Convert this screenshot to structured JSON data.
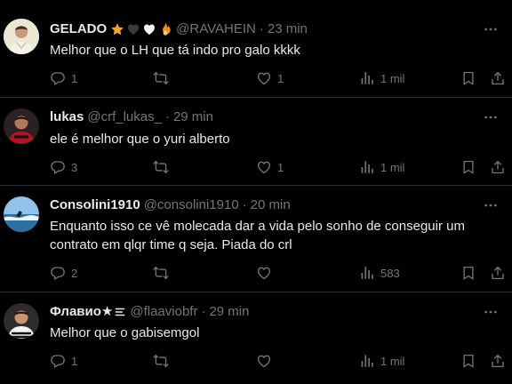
{
  "tweets": [
    {
      "name": "GELADO",
      "name_emojis": [
        "star",
        "black-heart",
        "white-heart",
        "fire"
      ],
      "handle": "@RAVAHEIN",
      "dot": "·",
      "time": "23 min",
      "text": "Melhor que o LH que tá indo pro galo kkkk",
      "replies": "1",
      "retweets": "",
      "likes": "1",
      "views": "1 mil"
    },
    {
      "name": "lukas",
      "handle": "@crf_lukas_",
      "dot": "·",
      "time": "29 min",
      "text": "ele é melhor que o yuri alberto",
      "replies": "3",
      "retweets": "",
      "likes": "1",
      "views": "1 mil"
    },
    {
      "name": "Consolini1910",
      "handle": "@consolini1910",
      "dot": "·",
      "time": "20 min",
      "text": "Enquanto isso ce vê molecada dar a vida pelo sonho de conseguir um contrato em qlqr time q seja. Piada do crl",
      "replies": "2",
      "retweets": "",
      "likes": "",
      "views": "583"
    },
    {
      "name": "Флавио★",
      "handle": "@flaaviobfr",
      "dot": "·",
      "time": "29 min",
      "text": "Melhor que o gabisemgol",
      "replies": "1",
      "retweets": "",
      "likes": "",
      "views": "1 mil"
    }
  ],
  "icons": {
    "reply": "reply-icon",
    "retweet": "retweet-icon",
    "like": "heart-icon",
    "views": "views-chart-icon",
    "bookmark": "bookmark-icon",
    "share": "share-icon",
    "more": "more-options-icon"
  },
  "colors": {
    "background": "#000000",
    "text": "#e7e9ea",
    "muted": "#71767b",
    "divider": "#2f3336"
  }
}
